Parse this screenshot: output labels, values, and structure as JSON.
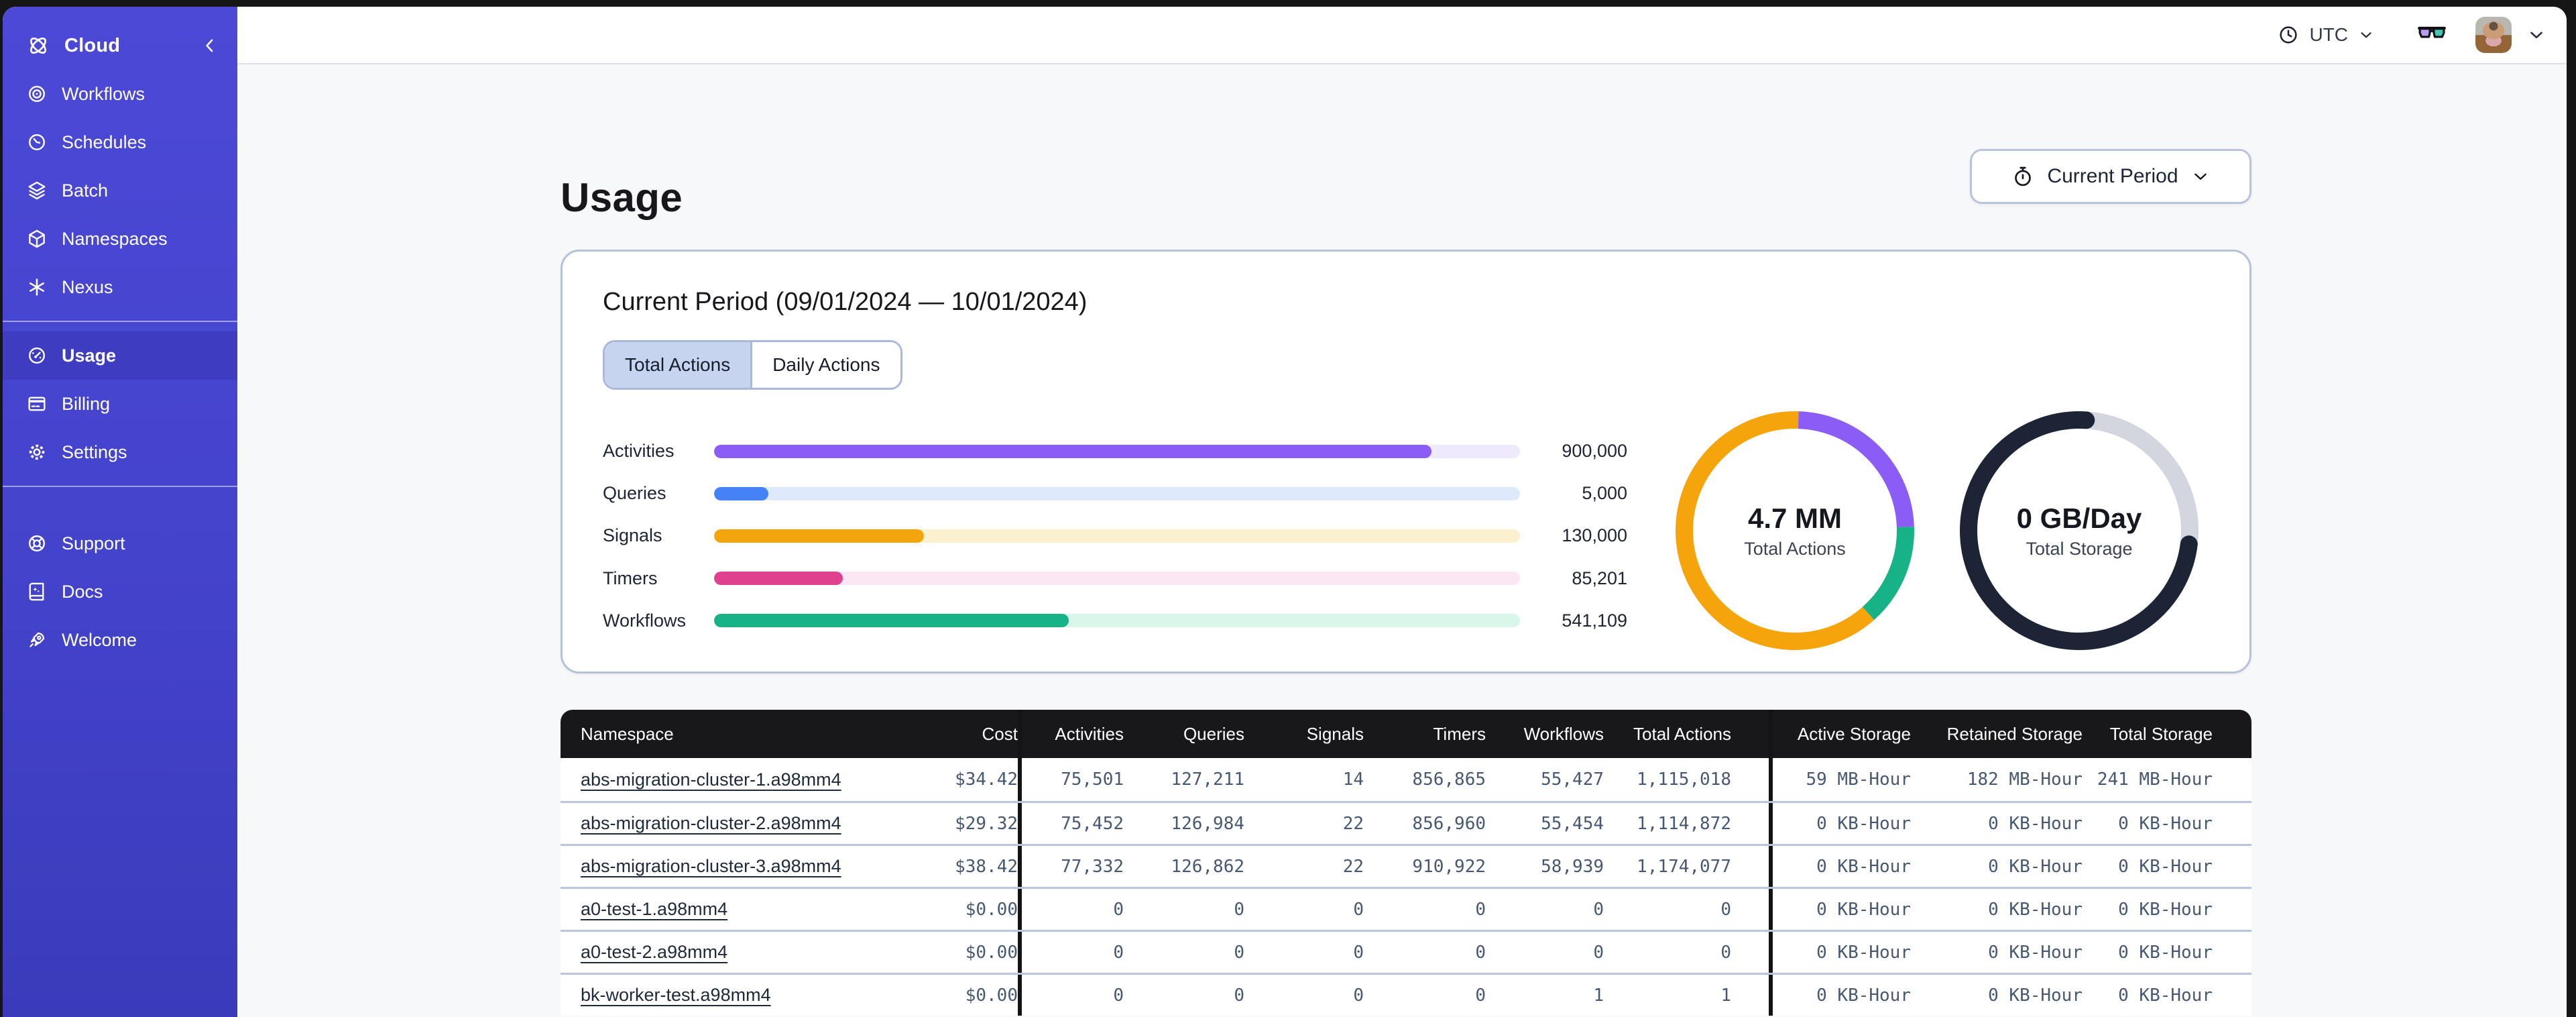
{
  "topbar": {
    "timezone": "UTC"
  },
  "sidebar": {
    "brand": "Cloud",
    "items": [
      {
        "label": "Workflows"
      },
      {
        "label": "Schedules"
      },
      {
        "label": "Batch"
      },
      {
        "label": "Namespaces"
      },
      {
        "label": "Nexus"
      },
      {
        "label": "Usage",
        "selected": true
      },
      {
        "label": "Billing"
      },
      {
        "label": "Settings"
      },
      {
        "label": "Support"
      },
      {
        "label": "Docs"
      },
      {
        "label": "Welcome"
      }
    ]
  },
  "page": {
    "title": "Usage",
    "period_selector_label": "Current Period"
  },
  "usage_card": {
    "title": "Current Period (09/01/2024 — 10/01/2024)",
    "tabs": [
      {
        "label": "Total Actions",
        "selected": true
      },
      {
        "label": "Daily Actions",
        "selected": false
      }
    ]
  },
  "colors": {
    "sidebar": "#4B49D6",
    "sidebar_selected": "#3E3CC0",
    "header_black": "#18181b",
    "glasses_left_lens": "#B49DF3",
    "glasses_right_lens": "#45C9AE"
  },
  "chart_data": [
    {
      "type": "bar",
      "title": "Total Actions by type",
      "categories": [
        "Activities",
        "Queries",
        "Signals",
        "Timers",
        "Workflows"
      ],
      "values": [
        900000,
        5000,
        130000,
        85201,
        541109
      ],
      "value_labels": [
        "900,000",
        "5,000",
        "130,000",
        "85,201",
        "541,109"
      ],
      "fill_percent": [
        89,
        6.7,
        26,
        16,
        44
      ],
      "colors": [
        "#8B5CF6",
        "#4483F5",
        "#F2A50C",
        "#E0418F",
        "#17B387"
      ],
      "track_colors": [
        "#EEE9FC",
        "#DEE9FB",
        "#FBF1CF",
        "#FBE7F4",
        "#D9F6EB"
      ]
    },
    {
      "type": "donut",
      "center_value": "4.7 MM",
      "center_label": "Total Actions",
      "segments": [
        {
          "name": "purple",
          "color": "#8B5CF6",
          "percent": 24,
          "start": 0.5
        },
        {
          "name": "green",
          "color": "#17B387",
          "percent": 14,
          "start": 24.5
        },
        {
          "name": "orange",
          "color": "#F5A40B",
          "percent": 62,
          "start": 38.5
        }
      ]
    },
    {
      "type": "donut",
      "center_value": "0 GB/Day",
      "center_label": "Total Storage",
      "segments": [
        {
          "name": "track",
          "color": "#D3D6DE",
          "percent": 26,
          "start": 1
        },
        {
          "name": "used",
          "color": "#1C2435",
          "percent": 74,
          "start": 27,
          "round": true
        }
      ]
    }
  ],
  "table": {
    "columns": [
      "Namespace",
      "Cost",
      "Activities",
      "Queries",
      "Signals",
      "Timers",
      "Workflows",
      "Total Actions",
      "Active Storage",
      "Retained Storage",
      "Total Storage"
    ],
    "rows": [
      [
        "abs-migration-cluster-1.a98mm4",
        "$34.42",
        "75,501",
        "127,211",
        "14",
        "856,865",
        "55,427",
        "1,115,018",
        "59 MB-Hour",
        "182 MB-Hour",
        "241 MB-Hour"
      ],
      [
        "abs-migration-cluster-2.a98mm4",
        "$29.32",
        "75,452",
        "126,984",
        "22",
        "856,960",
        "55,454",
        "1,114,872",
        "0 KB-Hour",
        "0 KB-Hour",
        "0 KB-Hour"
      ],
      [
        "abs-migration-cluster-3.a98mm4",
        "$38.42",
        "77,332",
        "126,862",
        "22",
        "910,922",
        "58,939",
        "1,174,077",
        "0 KB-Hour",
        "0 KB-Hour",
        "0 KB-Hour"
      ],
      [
        "a0-test-1.a98mm4",
        "$0.00",
        "0",
        "0",
        "0",
        "0",
        "0",
        "0",
        "0 KB-Hour",
        "0 KB-Hour",
        "0 KB-Hour"
      ],
      [
        "a0-test-2.a98mm4",
        "$0.00",
        "0",
        "0",
        "0",
        "0",
        "0",
        "0",
        "0 KB-Hour",
        "0 KB-Hour",
        "0 KB-Hour"
      ],
      [
        "bk-worker-test.a98mm4",
        "$0.00",
        "0",
        "0",
        "0",
        "0",
        "1",
        "1",
        "0 KB-Hour",
        "0 KB-Hour",
        "0 KB-Hour"
      ]
    ]
  }
}
